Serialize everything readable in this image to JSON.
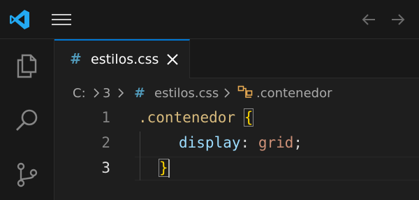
{
  "titlebar": {
    "logo_icon": "vscode-logo-icon",
    "menu_icon": "hamburger-menu-icon",
    "back_icon": "arrow-left-icon",
    "forward_icon": "arrow-right-icon"
  },
  "activitybar": {
    "items": [
      {
        "name": "explorer",
        "icon": "files-icon"
      },
      {
        "name": "search",
        "icon": "search-icon"
      },
      {
        "name": "source-control",
        "icon": "source-control-icon"
      }
    ]
  },
  "tab": {
    "icon_glyph": "#",
    "label": "estilos.css",
    "close_icon": "close-icon"
  },
  "breadcrumb": {
    "drive": "C:",
    "folder": "3",
    "file_icon_glyph": "#",
    "file": "estilos.css",
    "symbol_icon": "css-selector-icon",
    "symbol": ".contenedor"
  },
  "editor": {
    "line_numbers": [
      "1",
      "2",
      "3"
    ],
    "active_line": 3,
    "lines": {
      "l1_selector": ".contenedor",
      "l1_brace": "{",
      "l2_property": "display",
      "l2_colon": ":",
      "l2_value": "grid",
      "l2_semicolon": ";",
      "l3_brace": "}"
    }
  },
  "colors": {
    "accent": "#0078d4",
    "css_icon": "#519aba",
    "selector": "#d7ba7d",
    "brace": "#ffd700",
    "property": "#9cdcfe",
    "value": "#ce9178"
  }
}
